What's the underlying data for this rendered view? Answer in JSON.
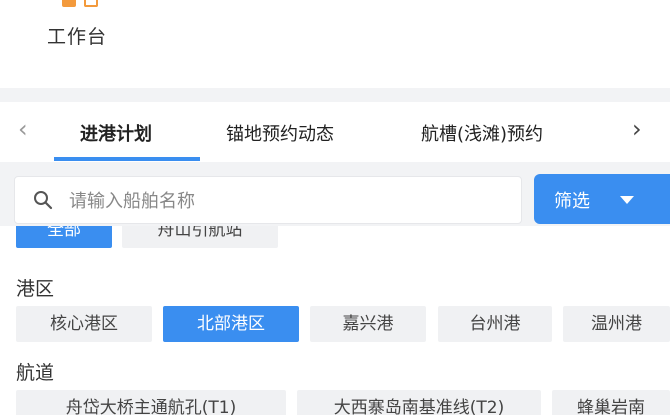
{
  "workbench": {
    "label": "工作台"
  },
  "tabs": {
    "items": [
      {
        "label": "进港计划",
        "active": true
      },
      {
        "label": "锚地预约动态",
        "active": false
      },
      {
        "label": "航槽(浅滩)预约",
        "active": false
      }
    ],
    "prev_icon": "chevron-left-icon",
    "next_icon": "chevron-right-icon"
  },
  "search": {
    "placeholder": "请输入船舶名称",
    "value": "",
    "icon": "search-icon"
  },
  "filter": {
    "label": "筛选",
    "icon": "caret-down-icon"
  },
  "top_row": {
    "chips": [
      {
        "label": "全部",
        "selected": true
      },
      {
        "label": "舟山引航站",
        "selected": false
      }
    ]
  },
  "port_area": {
    "label": "港区",
    "chips": [
      {
        "label": "核心港区",
        "selected": false
      },
      {
        "label": "北部港区",
        "selected": true
      },
      {
        "label": "嘉兴港",
        "selected": false
      },
      {
        "label": "台州港",
        "selected": false
      },
      {
        "label": "温州港",
        "selected": false
      }
    ]
  },
  "channel": {
    "label": "航道",
    "chips": [
      {
        "label": "舟岱大桥主通航孔(T1)",
        "selected": false
      },
      {
        "label": "大西寨岛南基准线(T2)",
        "selected": false
      },
      {
        "label": "蜂巢岩南",
        "selected": false
      }
    ]
  },
  "colors": {
    "accent": "#3a8ef0",
    "chip_bg": "#f0f1f3",
    "page_bg": "#f2f3f5",
    "brand_orange": "#f39a3c"
  }
}
